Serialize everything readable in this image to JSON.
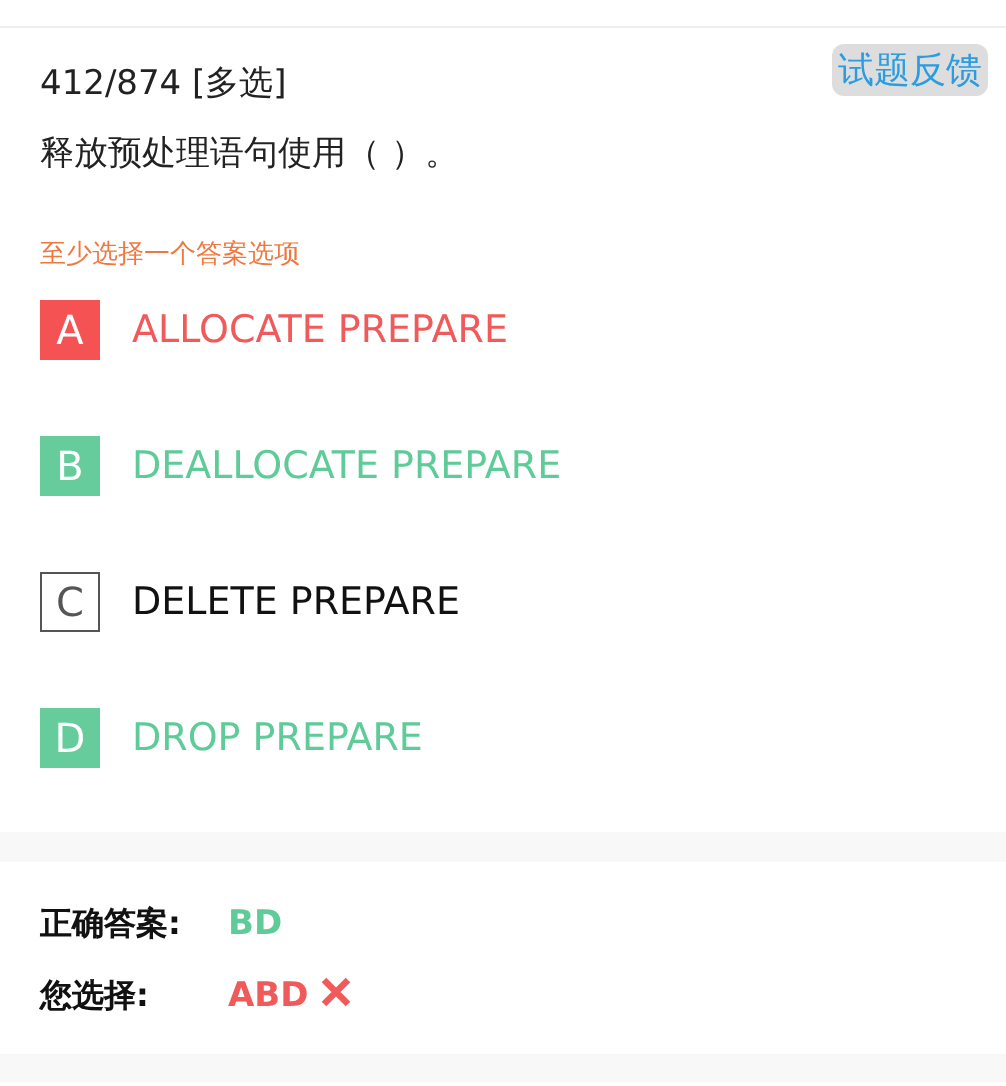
{
  "question": {
    "counter": "412/874",
    "type_tag": "[多选]",
    "feedback_button": "试题反馈",
    "text": "释放预处理语句使用（ ）。",
    "hint": "至少选择一个答案选项"
  },
  "options": [
    {
      "letter": "A",
      "text": "ALLOCATE PREPARE",
      "kind": "wrong"
    },
    {
      "letter": "B",
      "text": "DEALLOCATE PREPARE",
      "kind": "correct"
    },
    {
      "letter": "C",
      "text": "DELETE PREPARE",
      "kind": "plain"
    },
    {
      "letter": "D",
      "text": "DROP PREPARE",
      "kind": "correct"
    }
  ],
  "result": {
    "correct_label": "正确答案:",
    "correct_answer": "BD",
    "your_label": "您选择:",
    "your_answer": "ABD",
    "is_correct": false
  }
}
